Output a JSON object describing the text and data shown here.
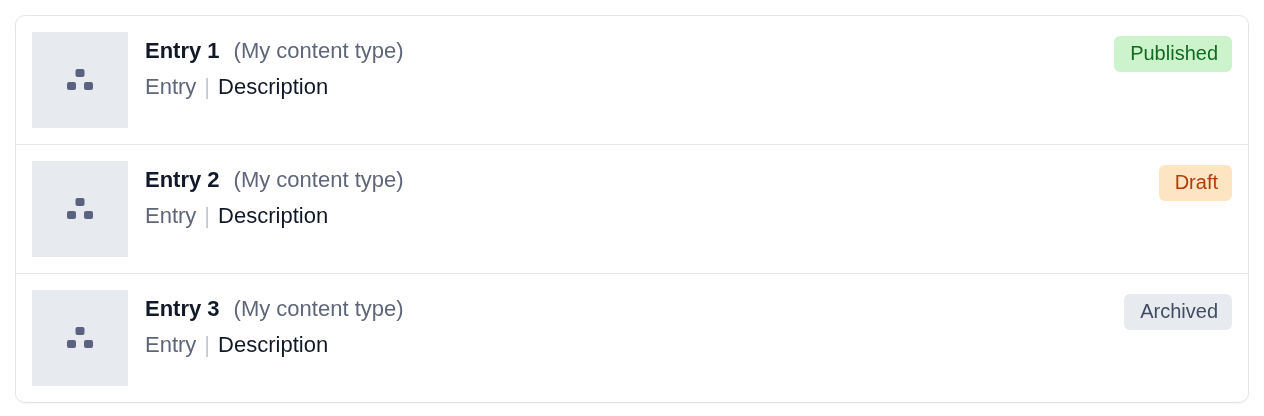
{
  "entries": [
    {
      "title": "Entry 1",
      "content_type": "(My content type)",
      "type_label": "Entry",
      "separator": "|",
      "description": "Description",
      "status": {
        "label": "Published",
        "kind": "published"
      }
    },
    {
      "title": "Entry 2",
      "content_type": "(My content type)",
      "type_label": "Entry",
      "separator": "|",
      "description": "Description",
      "status": {
        "label": "Draft",
        "kind": "draft"
      }
    },
    {
      "title": "Entry 3",
      "content_type": "(My content type)",
      "type_label": "Entry",
      "separator": "|",
      "description": "Description",
      "status": {
        "label": "Archived",
        "kind": "archived"
      }
    }
  ]
}
